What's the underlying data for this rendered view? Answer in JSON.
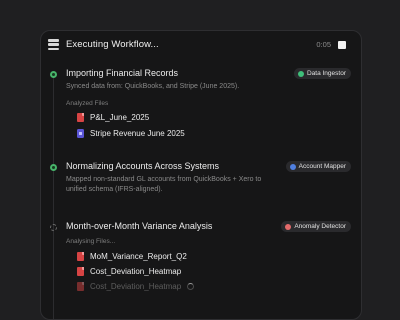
{
  "header": {
    "title": "Executing Workflow...",
    "timer": "0:05",
    "stop_icon": "stop-icon",
    "workflow_icon": "workflow-stack-icon"
  },
  "steps": [
    {
      "title": "Importing Financial Records",
      "description": "Synced data from: QuickBooks, and Stripe (June 2025).",
      "status": "done",
      "agent": {
        "label": "Data Ingestor",
        "color": "#3fbf7a"
      },
      "files_label": "Analyzed Files",
      "files": [
        {
          "name": "P&L_June_2025",
          "icon": "pdf-file-icon"
        },
        {
          "name": "Stripe Revenue June 2025",
          "icon": "stripe-icon"
        }
      ]
    },
    {
      "title": "Normalizing Accounts Across Systems",
      "description": "Mapped non-standard GL accounts from QuickBooks + Xero to unified schema (IFRS-aligned).",
      "status": "done",
      "agent": {
        "label": "Account Mapper",
        "color": "#4f7fe0"
      }
    },
    {
      "title": "Month-over-Month Variance Analysis",
      "status": "in-progress",
      "agent": {
        "label": "Anomaly Detector",
        "color": "#e36a6a"
      },
      "files_label": "Analysing Files...",
      "files": [
        {
          "name": "MoM_Variance_Report_Q2",
          "icon": "pdf-file-icon"
        },
        {
          "name": "Cost_Deviation_Heatmap",
          "icon": "pdf-file-icon"
        },
        {
          "name": "Cost_Deviation_Heatmap",
          "icon": "pdf-file-icon",
          "loading": true
        }
      ]
    }
  ],
  "colors": {
    "done": "#47b46a",
    "background": "#1f1f21",
    "panel": "#161617"
  }
}
